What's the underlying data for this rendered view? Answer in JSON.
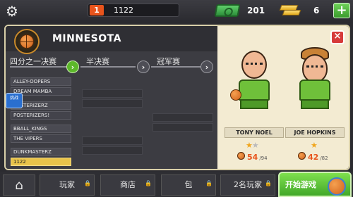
{
  "topbar": {
    "level": "1",
    "xp": "1122",
    "cash": "201",
    "gold": "6",
    "icons": [
      "gear-icon",
      "cash-icon",
      "gold-bars-icon",
      "plus-icon"
    ]
  },
  "panel": {
    "team_name": "MINNESOTA",
    "rounds": [
      "四分之一决赛",
      "半决赛",
      "冠军赛"
    ],
    "bracket_teams": [
      [
        "ALLEY-OOPERS",
        "DREAM MAMBA"
      ],
      [
        "POSTERIZERZ",
        "POSTERIZERS!"
      ],
      [
        "BBALL_KINGS",
        "THE VIPERS"
      ],
      [
        "DUNKMASTERZ",
        "1122"
      ]
    ],
    "badge_label": "挑战"
  },
  "players": [
    {
      "name": "TONY NOEL",
      "stars_full": 1,
      "stars_half": 1,
      "stars_total": 2,
      "stat": "54",
      "max": "/94"
    },
    {
      "name": "JOE HOPKINS",
      "stars_full": 1,
      "stars_half": 0,
      "stars_total": 1,
      "stat": "42",
      "max": "/82"
    }
  ],
  "bottombar": {
    "tabs": [
      "玩家",
      "商店",
      "包",
      "2名玩家"
    ],
    "start_label": "开始游戏"
  },
  "colors": {
    "accent_green": "#5cb82a",
    "accent_orange": "#e8541c",
    "panel_cream": "#f3ebd2",
    "my_team_yellow": "#e8c34a"
  }
}
